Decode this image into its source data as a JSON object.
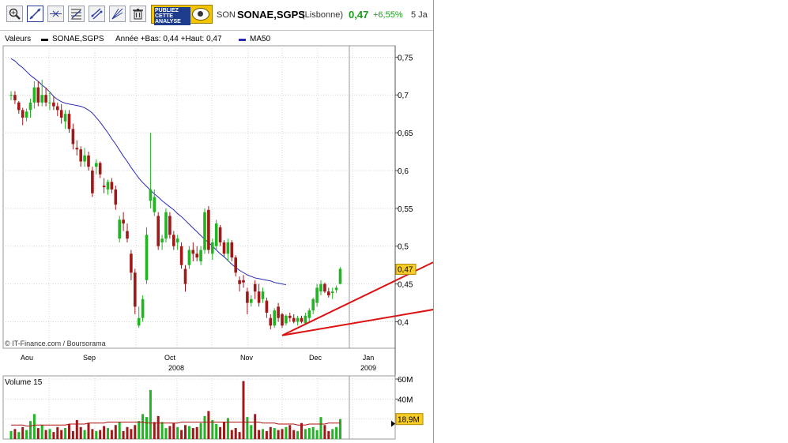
{
  "toolbar": {
    "buttons": [
      {
        "name": "zoom-tool-button",
        "icon": "magnifier-icon"
      },
      {
        "name": "trendline-tool-button",
        "icon": "trendline-icon"
      },
      {
        "name": "crosshair-tool-button",
        "icon": "crosshair-icon"
      },
      {
        "name": "indicators-tool-button",
        "icon": "indicators-icon"
      },
      {
        "name": "channel-tool-button",
        "icon": "channel-icon"
      },
      {
        "name": "fibonacci-tool-button",
        "icon": "fan-icon"
      },
      {
        "name": "delete-tool-button",
        "icon": "trash-icon"
      }
    ],
    "ad_text": "PUBLIEZ CETTE ANALYSE"
  },
  "header": {
    "code": "SON",
    "name": "SONAE,SGPS",
    "exchange": "(Lisbonne)",
    "price": "0,47",
    "change": "+6,55%",
    "period": "5 Ja"
  },
  "legend": {
    "label": "Valeurs",
    "series": "SONAE,SGPS",
    "range": "Année +Bas: 0,44 +Haut: 0,47",
    "ma": "MA50"
  },
  "watermark": "© IT-Finance.com / Boursorama",
  "colors": {
    "up": "#22b422",
    "down": "#a01818",
    "ma": "#2a2ab4",
    "trend": "#dd1111",
    "vol_ma": "#b01010",
    "price_tag": "#f6cc29"
  },
  "chart_data": {
    "type": "candlestick",
    "price_axis": {
      "ticks": [
        "0,75",
        "0,7",
        "0,65",
        "0,6",
        "0,55",
        "0,5",
        "0,45",
        "0,4"
      ],
      "tick_values": [
        0.75,
        0.7,
        0.65,
        0.6,
        0.55,
        0.5,
        0.45,
        0.4
      ],
      "ylim": [
        0.365,
        0.765
      ]
    },
    "x_labels": [
      "Aou",
      "Sep",
      "Oct",
      "Nov",
      "Dec",
      "Jan"
    ],
    "year_labels": [
      "2008",
      "2009"
    ],
    "last_price_tag": "0,47",
    "candles": [
      [
        0.7,
        0.705,
        0.693,
        0.7
      ],
      [
        0.7,
        0.705,
        0.688,
        0.693
      ],
      [
        0.69,
        0.692,
        0.675,
        0.68
      ],
      [
        0.68,
        0.683,
        0.66,
        0.67
      ],
      [
        0.67,
        0.682,
        0.665,
        0.678
      ],
      [
        0.68,
        0.695,
        0.67,
        0.69
      ],
      [
        0.69,
        0.718,
        0.682,
        0.71
      ],
      [
        0.71,
        0.718,
        0.685,
        0.69
      ],
      [
        0.69,
        0.72,
        0.685,
        0.7
      ],
      [
        0.7,
        0.71,
        0.685,
        0.69
      ],
      [
        0.69,
        0.705,
        0.68,
        0.69
      ],
      [
        0.69,
        0.698,
        0.68,
        0.685
      ],
      [
        0.685,
        0.69,
        0.672,
        0.68
      ],
      [
        0.68,
        0.688,
        0.662,
        0.67
      ],
      [
        0.665,
        0.68,
        0.655,
        0.675
      ],
      [
        0.675,
        0.68,
        0.65,
        0.655
      ],
      [
        0.655,
        0.662,
        0.628,
        0.635
      ],
      [
        0.63,
        0.64,
        0.62,
        0.628
      ],
      [
        0.628,
        0.632,
        0.605,
        0.612
      ],
      [
        0.612,
        0.63,
        0.605,
        0.62
      ],
      [
        0.62,
        0.625,
        0.6,
        0.605
      ],
      [
        0.6,
        0.605,
        0.565,
        0.57
      ],
      [
        0.605,
        0.615,
        0.595,
        0.61
      ],
      [
        0.61,
        0.612,
        0.59,
        0.595
      ],
      [
        0.58,
        0.59,
        0.57,
        0.578
      ],
      [
        0.575,
        0.588,
        0.568,
        0.585
      ],
      [
        0.585,
        0.59,
        0.57,
        0.575
      ],
      [
        0.575,
        0.58,
        0.548,
        0.555
      ],
      [
        0.51,
        0.54,
        0.505,
        0.535
      ],
      [
        0.535,
        0.545,
        0.52,
        0.53
      ],
      [
        0.52,
        0.53,
        0.505,
        0.51
      ],
      [
        0.49,
        0.495,
        0.455,
        0.465
      ],
      [
        0.465,
        0.47,
        0.41,
        0.42
      ],
      [
        0.395,
        0.42,
        0.392,
        0.405
      ],
      [
        0.405,
        0.435,
        0.4,
        0.43
      ],
      [
        0.455,
        0.525,
        0.45,
        0.515
      ],
      [
        0.56,
        0.65,
        0.55,
        0.575
      ],
      [
        0.545,
        0.575,
        0.54,
        0.565
      ],
      [
        0.54,
        0.545,
        0.495,
        0.5
      ],
      [
        0.505,
        0.515,
        0.495,
        0.51
      ],
      [
        0.51,
        0.55,
        0.505,
        0.545
      ],
      [
        0.54,
        0.545,
        0.51,
        0.515
      ],
      [
        0.515,
        0.52,
        0.495,
        0.5
      ],
      [
        0.505,
        0.515,
        0.495,
        0.51
      ],
      [
        0.5,
        0.505,
        0.47,
        0.475
      ],
      [
        0.47,
        0.475,
        0.44,
        0.45
      ],
      [
        0.475,
        0.5,
        0.47,
        0.495
      ],
      [
        0.495,
        0.505,
        0.48,
        0.49
      ],
      [
        0.49,
        0.5,
        0.48,
        0.485
      ],
      [
        0.48,
        0.5,
        0.475,
        0.495
      ],
      [
        0.495,
        0.55,
        0.49,
        0.545
      ],
      [
        0.548,
        0.553,
        0.49,
        0.495
      ],
      [
        0.49,
        0.51,
        0.482,
        0.505
      ],
      [
        0.5,
        0.535,
        0.495,
        0.53
      ],
      [
        0.525,
        0.528,
        0.5,
        0.505
      ],
      [
        0.505,
        0.508,
        0.485,
        0.49
      ],
      [
        0.49,
        0.51,
        0.48,
        0.505
      ],
      [
        0.505,
        0.508,
        0.48,
        0.485
      ],
      [
        0.485,
        0.488,
        0.46,
        0.465
      ],
      [
        0.455,
        0.46,
        0.44,
        0.45
      ],
      [
        0.455,
        0.462,
        0.445,
        0.452
      ],
      [
        0.44,
        0.445,
        0.41,
        0.425
      ],
      [
        0.425,
        0.435,
        0.42,
        0.43
      ],
      [
        0.45,
        0.455,
        0.43,
        0.44
      ],
      [
        0.44,
        0.45,
        0.42,
        0.425
      ],
      [
        0.43,
        0.445,
        0.425,
        0.44
      ],
      [
        0.428,
        0.432,
        0.405,
        0.412
      ],
      [
        0.405,
        0.41,
        0.39,
        0.395
      ],
      [
        0.395,
        0.418,
        0.392,
        0.415
      ],
      [
        0.42,
        0.425,
        0.4,
        0.405
      ],
      [
        0.41,
        0.412,
        0.392,
        0.395
      ],
      [
        0.398,
        0.41,
        0.395,
        0.408
      ],
      [
        0.408,
        0.412,
        0.4,
        0.405
      ],
      [
        0.405,
        0.41,
        0.398,
        0.4
      ],
      [
        0.4,
        0.408,
        0.395,
        0.405
      ],
      [
        0.405,
        0.408,
        0.398,
        0.4
      ],
      [
        0.398,
        0.412,
        0.396,
        0.408
      ],
      [
        0.405,
        0.418,
        0.4,
        0.415
      ],
      [
        0.415,
        0.432,
        0.41,
        0.43
      ],
      [
        0.425,
        0.45,
        0.42,
        0.445
      ],
      [
        0.44,
        0.455,
        0.435,
        0.45
      ],
      [
        0.45,
        0.452,
        0.438,
        0.44
      ],
      [
        0.44,
        0.445,
        0.432,
        0.435
      ],
      [
        0.438,
        0.445,
        0.43,
        0.44
      ],
      [
        0.442,
        0.448,
        0.438,
        0.445
      ],
      [
        0.45,
        0.472,
        0.45,
        0.47
      ]
    ],
    "ma50": [
      0.748,
      0.745,
      0.74,
      0.736,
      0.731,
      0.726,
      0.722,
      0.718,
      0.713,
      0.709,
      0.704,
      0.698,
      0.694,
      0.691,
      0.689,
      0.688,
      0.687,
      0.686,
      0.685,
      0.683,
      0.68,
      0.676,
      0.67,
      0.664,
      0.657,
      0.65,
      0.642,
      0.635,
      0.627,
      0.619,
      0.612,
      0.604,
      0.597,
      0.59,
      0.584,
      0.579,
      0.574,
      0.569,
      0.565,
      0.56,
      0.556,
      0.552,
      0.548,
      0.543,
      0.539,
      0.534,
      0.529,
      0.524,
      0.519,
      0.514,
      0.509,
      0.505,
      0.5,
      0.495,
      0.49,
      0.486,
      0.481,
      0.476,
      0.472,
      0.468,
      0.465,
      0.462,
      0.46,
      0.458,
      0.457,
      0.456,
      0.455,
      0.454,
      0.452,
      0.451,
      0.45,
      0.449
    ],
    "trend_lines": [
      {
        "from": [
          70,
          0.382
        ],
        "to": [
          118,
          0.501
        ]
      },
      {
        "from": [
          70,
          0.382
        ],
        "to": [
          118,
          0.424
        ]
      }
    ],
    "volume": {
      "title": "Volume 15",
      "ticks": [
        "60M",
        "40M"
      ],
      "tick_values": [
        60,
        40
      ],
      "ylim": [
        0,
        60
      ],
      "last_volume_tag": "18,9M",
      "values": [
        8,
        10,
        7,
        12,
        9,
        18,
        25,
        11,
        14,
        9,
        10,
        7,
        12,
        9,
        11,
        15,
        8,
        19,
        12,
        9,
        16,
        10,
        8,
        9,
        13,
        11,
        9,
        14,
        17,
        8,
        12,
        10,
        14,
        18,
        25,
        22,
        49,
        17,
        23,
        17,
        11,
        13,
        16,
        12,
        9,
        14,
        13,
        11,
        12,
        16,
        23,
        28,
        19,
        15,
        12,
        17,
        21,
        9,
        11,
        7,
        58,
        22,
        14,
        25,
        9,
        10,
        8,
        12,
        11,
        9,
        10,
        12,
        14,
        9,
        8,
        16,
        10,
        11,
        12,
        9,
        22,
        14,
        8,
        10,
        12,
        20
      ],
      "up": [
        1,
        0,
        1,
        0,
        1,
        1,
        1,
        0,
        1,
        0,
        1,
        0,
        0,
        0,
        1,
        0,
        0,
        0,
        0,
        1,
        0,
        0,
        1,
        0,
        0,
        1,
        0,
        0,
        1,
        0,
        0,
        0,
        0,
        1,
        1,
        1,
        1,
        0,
        0,
        1,
        1,
        0,
        0,
        1,
        0,
        0,
        1,
        0,
        0,
        1,
        1,
        0,
        1,
        1,
        0,
        0,
        1,
        0,
        0,
        0,
        0,
        1,
        1,
        0,
        0,
        1,
        0,
        0,
        1,
        0,
        0,
        1,
        0,
        0,
        1,
        0,
        1,
        1,
        1,
        1,
        1,
        0,
        0,
        1,
        1,
        1
      ],
      "ma": [
        14,
        14,
        14,
        14,
        13,
        13,
        14,
        14,
        14,
        14,
        14,
        14,
        14,
        14,
        14,
        15,
        15,
        15,
        15,
        15,
        16,
        16,
        16,
        16,
        16,
        17,
        17,
        17,
        17,
        17,
        17,
        17,
        17,
        17,
        17,
        16,
        16,
        16,
        16,
        16,
        16,
        16,
        16,
        16,
        17,
        17,
        17,
        17,
        17,
        17,
        17,
        17,
        17,
        17,
        17,
        17,
        17,
        17,
        17,
        17,
        17,
        17,
        17,
        17,
        17,
        16,
        16,
        16,
        16,
        15,
        15,
        15,
        15,
        15,
        14,
        14,
        14,
        15,
        15,
        15,
        15,
        15,
        16,
        16,
        16,
        16
      ]
    }
  }
}
